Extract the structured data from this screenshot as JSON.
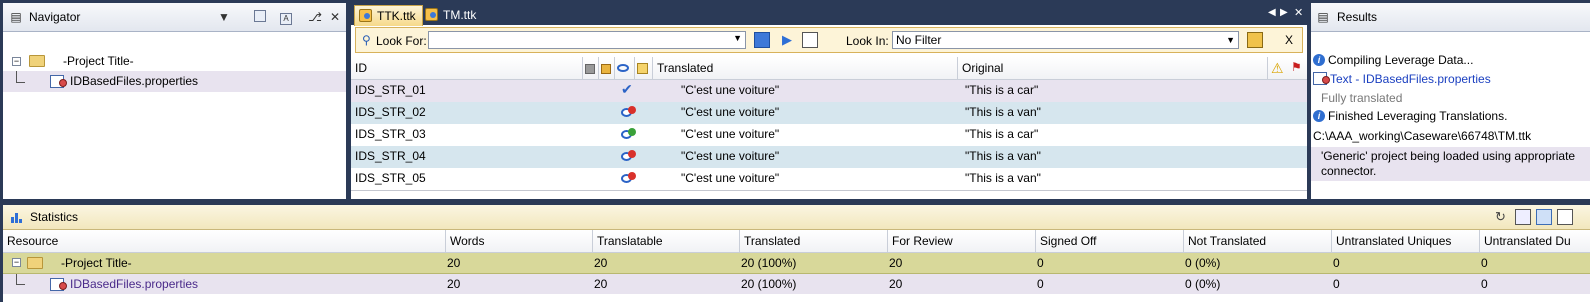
{
  "navigator": {
    "title": "Navigator",
    "tree": [
      {
        "label": "-Project Title-",
        "icon": "folder-icon"
      },
      {
        "label": "IDBasedFiles.properties",
        "icon": "properties-file-icon"
      }
    ]
  },
  "editor": {
    "tabs": [
      {
        "label": "TTK.ttk",
        "active": true
      },
      {
        "label": "TM.ttk",
        "active": false
      }
    ],
    "search": {
      "look_for_label": "Look For:",
      "look_for_value": "",
      "look_in_label": "Look In:",
      "look_in_value": "No Filter",
      "close_label": "X"
    },
    "columns": {
      "id": "ID",
      "translated": "Translated",
      "original": "Original"
    },
    "rows": [
      {
        "id": "IDS_STR_01",
        "status": "check-icon",
        "translated": "\"C'est une voiture\"",
        "original": "\"This is a car\""
      },
      {
        "id": "IDS_STR_02",
        "status": "not-validated-icon",
        "translated": "\"C'est une voiture\"",
        "original": "\"This is a van\""
      },
      {
        "id": "IDS_STR_03",
        "status": "leveraged-icon",
        "translated": "\"C'est une voiture\"",
        "original": "\"This is a car\""
      },
      {
        "id": "IDS_STR_04",
        "status": "not-validated-icon",
        "translated": "\"C'est une voiture\"",
        "original": "\"This is a van\""
      },
      {
        "id": "IDS_STR_05",
        "status": "not-validated-icon",
        "translated": "\"C'est une voiture\"",
        "original": "\"This is a van\""
      }
    ]
  },
  "results": {
    "title": "Results",
    "lines": [
      {
        "text": "Compiling Leverage Data...",
        "icon": "info-icon"
      },
      {
        "text": "Text - IDBasedFiles.properties",
        "icon": "properties-file-icon"
      },
      {
        "text": "Fully translated",
        "icon": ""
      },
      {
        "text": "Finished Leveraging Translations.",
        "icon": "info-icon"
      },
      {
        "text": "C:\\AAA_working\\Caseware\\66748\\TM.ttk",
        "icon": ""
      },
      {
        "text": "'Generic' project being loaded using appropriate",
        "icon": ""
      },
      {
        "text": "connector.",
        "icon": ""
      }
    ]
  },
  "statistics": {
    "title": "Statistics",
    "columns": [
      "Resource",
      "Words",
      "Translatable",
      "Translated",
      "For Review",
      "Signed Off",
      "Not Translated",
      "Untranslated Uniques",
      "Untranslated Du"
    ],
    "rows": [
      {
        "resource": "-Project Title-",
        "values": [
          "20",
          "20",
          "20 (100%)",
          "20",
          "0",
          "0 (0%)",
          "0",
          "0"
        ]
      },
      {
        "resource": "IDBasedFiles.properties",
        "values": [
          "20",
          "20",
          "20 (100%)",
          "20",
          "0",
          "0 (0%)",
          "0",
          "0"
        ]
      }
    ]
  },
  "colors": {
    "frame": "#2b3a57",
    "selected_row": "#e8e3ef",
    "alt_row": "#d6e6ee",
    "stats_highlight": "#d8d89a",
    "link": "#1a3fc0"
  }
}
